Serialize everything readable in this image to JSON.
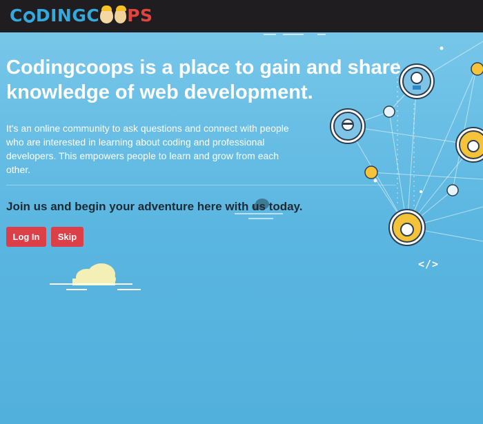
{
  "header": {
    "logo": {
      "part1": "C",
      "part2": "DINGC",
      "part3": "PS",
      "alt": "CODINGCOOPS"
    }
  },
  "hero": {
    "title": "Codingcoops is a place to gain and share knowledge of web development.",
    "description": "It's an online community to ask questions and connect with people who are interested in learning about coding and professional developers. This empowers people to learn and grow from each other.",
    "cta": "Join us and begin your adventure here with us today.",
    "login_label": "Log In",
    "skip_label": "Skip"
  },
  "illustration": {
    "code_tag": "</>"
  },
  "colors": {
    "header_bg": "#1f1d1f",
    "logo_blue": "#35a8dc",
    "logo_red": "#e1453f",
    "button": "#dc3f47",
    "background": "#5ab6e0"
  }
}
